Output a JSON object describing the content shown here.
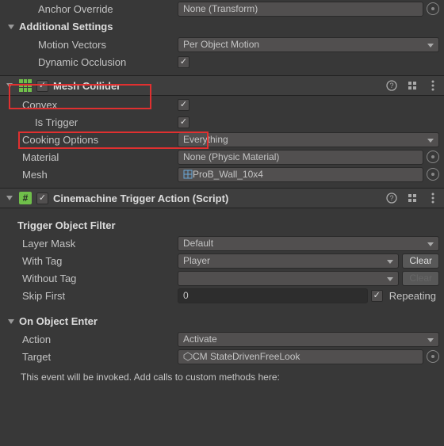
{
  "top": {
    "anchor_override_label": "Anchor Override",
    "anchor_override_value": "None (Transform)",
    "additional_settings": "Additional Settings",
    "motion_vectors_label": "Motion Vectors",
    "motion_vectors_value": "Per Object Motion",
    "dynamic_occlusion_label": "Dynamic Occlusion"
  },
  "mesh_collider": {
    "title": "Mesh Collider",
    "convex_label": "Convex",
    "is_trigger_label": "Is Trigger",
    "cooking_options_label": "Cooking Options",
    "cooking_options_value": "Everything",
    "material_label": "Material",
    "material_value": "None (Physic Material)",
    "mesh_label": "Mesh",
    "mesh_value": "ProB_Wall_10x4"
  },
  "cinemachine": {
    "title": "Cinemachine Trigger Action (Script)",
    "trigger_filter": "Trigger Object Filter",
    "layer_mask_label": "Layer Mask",
    "layer_mask_value": "Default",
    "with_tag_label": "With Tag",
    "with_tag_value": "Player",
    "without_tag_label": "Without Tag",
    "without_tag_value": "",
    "skip_first_label": "Skip First",
    "skip_first_value": "0",
    "repeating_label": "Repeating",
    "clear_label": "Clear",
    "on_object_enter": "On Object Enter",
    "action_label": "Action",
    "action_value": "Activate",
    "target_label": "Target",
    "target_value": "CM StateDrivenFreeLook",
    "note": "This event will be invoked.  Add calls to custom methods here:"
  }
}
